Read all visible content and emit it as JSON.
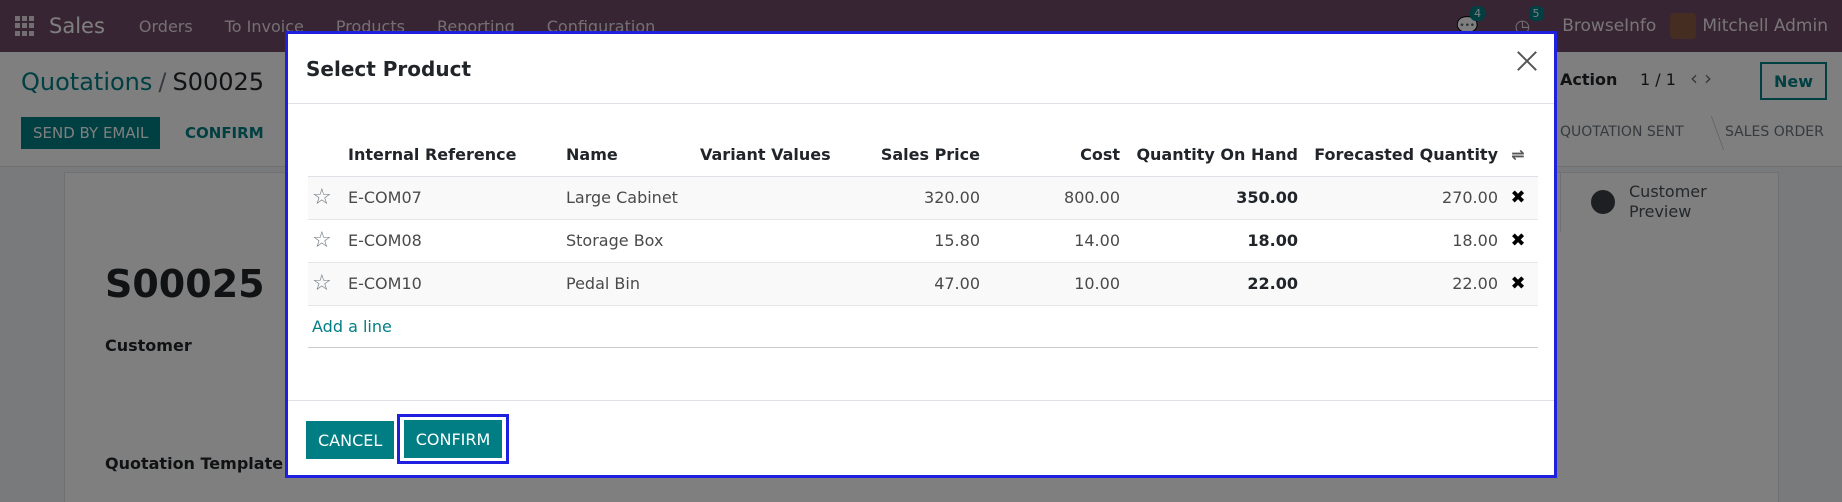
{
  "navbar": {
    "app_name": "Sales",
    "menu": [
      "Orders",
      "To Invoice",
      "Products",
      "Reporting",
      "Configuration"
    ],
    "messages_count": "4",
    "activities_count": "5",
    "company": "BrowseInfo",
    "user": "Mitchell Admin"
  },
  "control_panel": {
    "breadcrumb_parent": "Quotations",
    "breadcrumb_sep": "/",
    "breadcrumb_current": "S00025",
    "send_email_label": "SEND BY EMAIL",
    "confirm_label": "CONFIRM",
    "action_label": "Action",
    "pager": "1 / 1",
    "new_label": "New",
    "status_sent": "QUOTATION SENT",
    "status_order": "SALES ORDER"
  },
  "sheet": {
    "title": "S00025",
    "customer_label": "Customer",
    "template_label": "Quotation Template",
    "preview_label": "Customer Preview"
  },
  "modal": {
    "title": "Select Product",
    "columns": [
      "Internal Reference",
      "Name",
      "Variant Values",
      "Sales Price",
      "Cost",
      "Quantity On Hand",
      "Forecasted Quantity"
    ],
    "rows": [
      {
        "ref": "E-COM07",
        "name": "Large Cabinet",
        "variant": "",
        "price": "320.00",
        "cost": "800.00",
        "on_hand": "350.00",
        "forecast": "270.00"
      },
      {
        "ref": "E-COM08",
        "name": "Storage Box",
        "variant": "",
        "price": "15.80",
        "cost": "14.00",
        "on_hand": "18.00",
        "forecast": "18.00"
      },
      {
        "ref": "E-COM10",
        "name": "Pedal Bin",
        "variant": "",
        "price": "47.00",
        "cost": "10.00",
        "on_hand": "22.00",
        "forecast": "22.00"
      }
    ],
    "add_line": "Add a line",
    "cancel_label": "CANCEL",
    "confirm_label": "CONFIRM"
  },
  "colors": {
    "brand": "#714b67",
    "primary": "#017e84",
    "highlight": "#1f1fe0"
  }
}
